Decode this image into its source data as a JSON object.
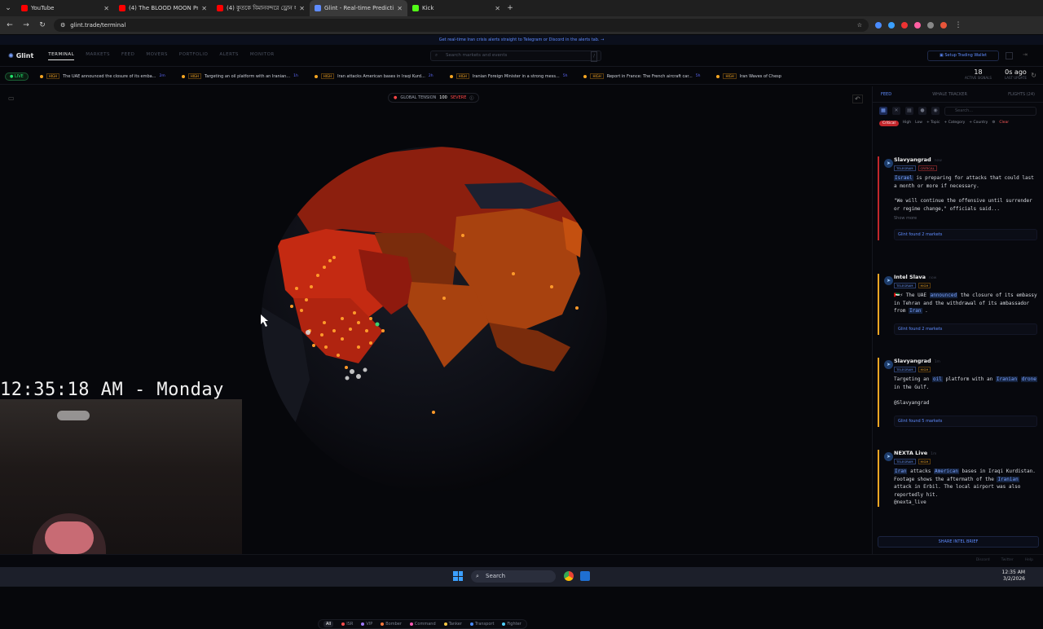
{
  "browser": {
    "tabs": [
      {
        "title": "YouTube",
        "color": "#ff0000"
      },
      {
        "title": "(4) The BLOOD MOON Prop",
        "color": "#ff0000"
      },
      {
        "title": "(4) কুতকে বিমানবন্দরে ড্রোন হা",
        "color": "#ff0000"
      },
      {
        "title": "Glint - Real-time Prediction Ma",
        "color": "#5f8cff",
        "active": true
      },
      {
        "title": "Kick",
        "color": "#53fc18"
      }
    ],
    "url": "glint.trade/terminal"
  },
  "app": {
    "banner": "Get real-time Iran crisis alerts straight to Telegram or Discord in the alerts tab. →",
    "logo": "Glint",
    "nav": [
      "TERMINAL",
      "MARKETS",
      "FEED",
      "MOVERS",
      "PORTFOLIO",
      "ALERTS",
      "MONITOR"
    ],
    "search_placeholder": "Search markets and events",
    "search_shortcut": "/",
    "setup_label": "Setup Trading Wallet",
    "live_label": "LIVE",
    "ticker": [
      {
        "level": "HIGH",
        "text": "The UAE announced the closure of its emba...",
        "age": "2m"
      },
      {
        "level": "HIGH",
        "text": "Targeting an oil platform with an Iranian...",
        "age": "1h"
      },
      {
        "level": "HIGH",
        "text": "Iran attacks American bases in Iraqi Kurd...",
        "age": "2h"
      },
      {
        "level": "HIGH",
        "text": "Iranian Foreign Minister in a strong mess...",
        "age": "5h"
      },
      {
        "level": "HIGH",
        "text": "Report in France: The French aircraft car...",
        "age": "5h"
      },
      {
        "level": "HIGH",
        "text": "Iran Waves of Chesp",
        "age": ""
      }
    ],
    "active_signals": {
      "value": "18",
      "label": "ACTIVE SIGNALS"
    },
    "last_update": {
      "value": "0s ago",
      "label": "LAST UPDATE"
    }
  },
  "globe": {
    "tension_label": "GLOBAL TENSION",
    "tension_value": "100",
    "tension_level": "SEVERE",
    "filters": [
      {
        "label": "All",
        "color": ""
      },
      {
        "label": "ISR",
        "color": "#ff4d4d"
      },
      {
        "label": "VIP",
        "color": "#a07aff"
      },
      {
        "label": "Bomber",
        "color": "#ff7a3d"
      },
      {
        "label": "Command",
        "color": "#ff5ab4"
      },
      {
        "label": "Tanker",
        "color": "#f5c542"
      },
      {
        "label": "Transport",
        "color": "#4a8cff"
      },
      {
        "label": "Fighter",
        "color": "#4fd1ff"
      }
    ]
  },
  "overlay": {
    "time": "12:35:18 AM - Monday"
  },
  "panel": {
    "tabs": [
      "FEED",
      "WHALE TRACKER",
      "FLIGHTS (24)"
    ],
    "search_placeholder": "Search...",
    "chips": [
      "Critical",
      "High",
      "Low",
      "+ Topic",
      "+ Category",
      "+ Country",
      "⚙",
      "Clear"
    ],
    "cards": [
      {
        "author": "Slavyangrad",
        "time": "now",
        "tags": [
          "TELEGRAM",
          "CRITICAL"
        ],
        "body_pre": "",
        "kw1": "Israel",
        "body_post": " is preparing for attacks that could last a month or more if necessary.",
        "quote": "\"We will continue the offensive until surrender or regime change,\" officials said...",
        "show_more": "Show more",
        "markets": "Glint found 2 markets"
      },
      {
        "author": "Intel Slava",
        "time": "now",
        "tags": [
          "TELEGRAM",
          "HIGH"
        ],
        "body_pre": "🇦🇪⚡ The UAE ",
        "kw1": "announced",
        "body_mid": " the closure of its embassy in Tehran and the withdrawal of its ambassador from ",
        "kw2": "Iran",
        "body_post": ".",
        "markets": "Glint found 2 markets"
      },
      {
        "author": "Slavyangrad",
        "time": "1m",
        "tags": [
          "TELEGRAM",
          "HIGH"
        ],
        "body_pre": "Targeting an ",
        "kw1": "oil",
        "body_mid": " platform with an ",
        "kw2": "Iranian",
        "kw3": "drone",
        "body_post": " in the Gulf.",
        "handle": "@Slavyangrad",
        "markets": "Glint found 5 markets"
      },
      {
        "author": "NEXTA Live",
        "time": "1m",
        "tags": [
          "TELEGRAM",
          "HIGH"
        ],
        "kw1": "Iran",
        "body_mid": " attacks ",
        "kw2": "American",
        "body_mid2": " bases in Iraqi Kurdistan. Footage shows the aftermath of the ",
        "kw3": "Iranian",
        "body_post": " attack in Erbil. The local airport was also reportedly hit.",
        "handle": "@nexta_live"
      }
    ],
    "share_label": "SHARE INTEL BRIEF"
  },
  "bottom": [
    "Discord",
    "Twitter",
    "Help"
  ],
  "taskbar": {
    "search": "Search",
    "time": "12:35 AM",
    "date": "3/2/2026"
  }
}
